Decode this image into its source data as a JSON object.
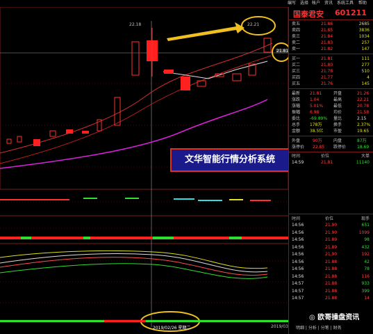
{
  "menu": [
    "编写",
    "选择",
    "帐户",
    "资讯",
    "系统工具",
    "帮助"
  ],
  "stock": {
    "name": "国泰君安",
    "code": "601211"
  },
  "order_book": {
    "asks": [
      {
        "label": "卖五",
        "price": "21.86",
        "volume": "2685"
      },
      {
        "label": "卖四",
        "price": "21.85",
        "volume": "3836"
      },
      {
        "label": "卖三",
        "price": "21.84",
        "volume": "1034"
      },
      {
        "label": "卖二",
        "price": "21.83",
        "volume": "257"
      },
      {
        "label": "卖一",
        "price": "21.82",
        "volume": "147"
      }
    ],
    "bids": [
      {
        "label": "买一",
        "price": "21.81",
        "volume": "111"
      },
      {
        "label": "买二",
        "price": "21.80",
        "volume": "277"
      },
      {
        "label": "买三",
        "price": "21.78",
        "volume": "510"
      },
      {
        "label": "买四",
        "price": "21.77",
        "volume": "4"
      },
      {
        "label": "买五",
        "price": "21.76",
        "volume": "145"
      }
    ]
  },
  "stats": [
    {
      "l1": "最新",
      "v1": "21.81",
      "l2": "开盘",
      "v2": "21.26"
    },
    {
      "l1": "涨跌",
      "v1": "1.04",
      "l2": "最高",
      "v2": "22.21"
    },
    {
      "l1": "涨幅",
      "v1": "5.01%",
      "l2": "最低",
      "v2": "20.78"
    },
    {
      "l1": "振幅",
      "v1": "6.98",
      "l2": "均价",
      "v2": "21.58"
    },
    {
      "l1": "委比",
      "v1": "-69.89%",
      "l2": "量比",
      "v2": "2.15"
    },
    {
      "l1": "总手",
      "v1": "178万",
      "l2": "换手",
      "v2": "2.37%"
    },
    {
      "l1": "金额",
      "v1": "38.5亿",
      "l2": "市盈",
      "v2": "19.65"
    }
  ],
  "stats2": [
    {
      "l1": "外盘",
      "v1": "90万",
      "l2": "内盘",
      "v2": "87万"
    },
    {
      "l1": "涨停价",
      "v1": "22.85",
      "l2": "跌停价",
      "v2": "18.69"
    }
  ],
  "mini_header": {
    "time": "时间",
    "price": "价位",
    "vol": "大单"
  },
  "mini_row": {
    "time": "14:59",
    "price": "21.81",
    "vol": "11140"
  },
  "ticks_header": {
    "time": "时间",
    "price": "价位",
    "vol": "现手"
  },
  "ticks": [
    {
      "time": "14:56",
      "price": "21.90",
      "vol": "651"
    },
    {
      "time": "14:56",
      "price": "21.90",
      "vol": "1099"
    },
    {
      "time": "14:56",
      "price": "21.89",
      "vol": "98"
    },
    {
      "time": "14:56",
      "price": "21.89",
      "vol": "432"
    },
    {
      "time": "14:56",
      "price": "21.90",
      "vol": "192"
    },
    {
      "time": "14:56",
      "price": "21.88",
      "vol": "42"
    },
    {
      "time": "14:56",
      "price": "21.88",
      "vol": "78"
    },
    {
      "time": "14:56",
      "price": "21.88",
      "vol": "116"
    },
    {
      "time": "14:57",
      "price": "21.88",
      "vol": "933"
    },
    {
      "time": "14:57",
      "price": "21.88",
      "vol": "399"
    },
    {
      "time": "14:57",
      "price": "21.88",
      "vol": "14"
    }
  ],
  "chart": {
    "high_label_left": "22.18",
    "high_label_right": "22.21",
    "price_marker": "21.81",
    "date_cursor": "2019/02/26 星期二",
    "date_end": "2019/03"
  },
  "watermark": "文华智能行情分析系统",
  "wechat": "欧哥操盘资讯",
  "tabs": [
    "明细",
    "分析",
    "分笔",
    "财务"
  ]
}
